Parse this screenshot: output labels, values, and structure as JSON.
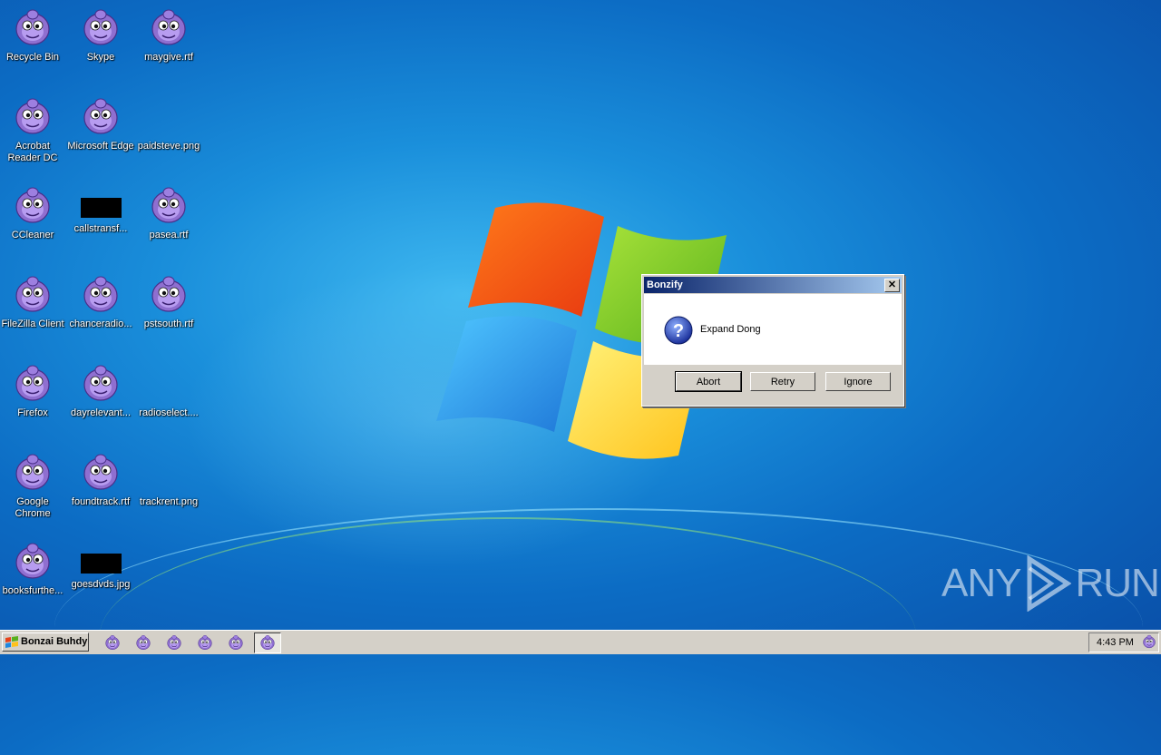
{
  "desktop": {
    "icons": [
      {
        "label": "Recycle Bin",
        "type": "gorilla"
      },
      {
        "label": "Skype",
        "type": "gorilla"
      },
      {
        "label": "maygive.rtf",
        "type": "gorilla"
      },
      {
        "label": "Acrobat Reader DC",
        "type": "gorilla"
      },
      {
        "label": "Microsoft Edge",
        "type": "gorilla"
      },
      {
        "label": "paidsteve.png",
        "type": "blank"
      },
      {
        "label": "CCleaner",
        "type": "gorilla"
      },
      {
        "label": "callstransf...",
        "type": "black-thumbnail"
      },
      {
        "label": "pasea.rtf",
        "type": "gorilla"
      },
      {
        "label": "FileZilla Client",
        "type": "gorilla"
      },
      {
        "label": "chanceradio...",
        "type": "gorilla"
      },
      {
        "label": "pstsouth.rtf",
        "type": "gorilla"
      },
      {
        "label": "Firefox",
        "type": "gorilla"
      },
      {
        "label": "dayrelevant...",
        "type": "gorilla"
      },
      {
        "label": "radioselect....",
        "type": "blank"
      },
      {
        "label": "Google Chrome",
        "type": "gorilla"
      },
      {
        "label": "foundtrack.rtf",
        "type": "gorilla"
      },
      {
        "label": "trackrent.png",
        "type": "blank"
      },
      {
        "label": "booksfurthe...",
        "type": "gorilla"
      },
      {
        "label": "goesdvds.jpg",
        "type": "black-thumbnail"
      }
    ]
  },
  "dialog": {
    "title": "Bonzify",
    "message": "Expand Dong",
    "icon": "question-icon",
    "buttons": {
      "abort": "Abort",
      "retry": "Retry",
      "ignore": "Ignore"
    }
  },
  "taskbar": {
    "start_label": "Bonzai Buhdy",
    "clock": "4:43 PM",
    "task_items": 6
  },
  "watermark": {
    "text_left": "ANY",
    "text_right": "RUN"
  },
  "colors": {
    "title_start": "#0a246a",
    "title_end": "#a6caf0",
    "gorilla": "#8f6fd0"
  }
}
